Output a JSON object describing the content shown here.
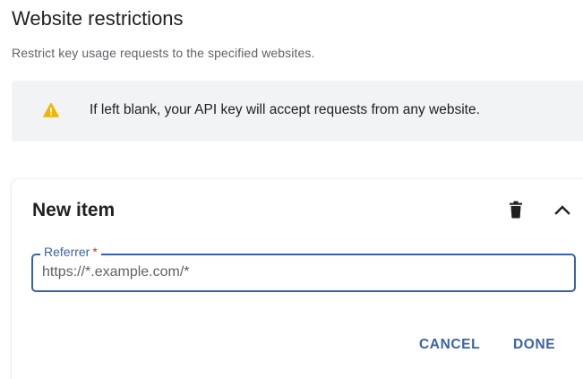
{
  "section": {
    "title": "Website restrictions",
    "description": "Restrict key usage requests to the specified websites."
  },
  "banner": {
    "icon": "warning-icon",
    "icon_color": "#f2b400",
    "text": "If left blank, your API key will accept requests from any website."
  },
  "item": {
    "title": "New item",
    "delete_icon": "trash-icon",
    "collapse_icon": "chevron-up-icon",
    "referrer": {
      "label": "Referrer",
      "required_marker": "*",
      "value": "",
      "placeholder": "https://*.example.com/*"
    },
    "actions": {
      "cancel_label": "CANCEL",
      "done_label": "DONE"
    }
  },
  "colors": {
    "accent": "#3b62a8",
    "required": "#d93025",
    "banner_bg": "#f1f3f4"
  }
}
